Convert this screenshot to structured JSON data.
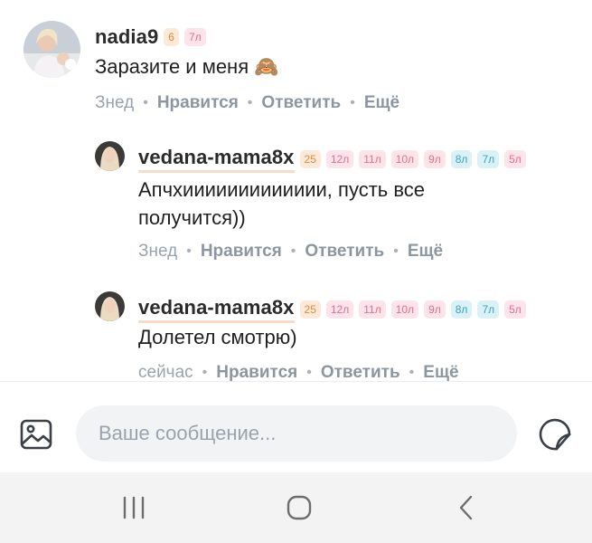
{
  "comments": [
    {
      "username": "nadia9",
      "badges": [
        {
          "text": "6",
          "kind": "level"
        },
        {
          "text": "7л",
          "kind": "pink"
        }
      ],
      "text": "Заразите и меня 🙈",
      "time": "Знед",
      "like": "Нравится",
      "reply": "Ответить",
      "more": "Ещё"
    },
    {
      "username": "vedana-mama8x",
      "badges": [
        {
          "text": "25",
          "kind": "level"
        },
        {
          "text": "12л",
          "kind": "pink"
        },
        {
          "text": "11л",
          "kind": "pink"
        },
        {
          "text": "10л",
          "kind": "pink"
        },
        {
          "text": "9л",
          "kind": "pink"
        },
        {
          "text": "8л",
          "kind": "blue"
        },
        {
          "text": "7л",
          "kind": "blue"
        },
        {
          "text": "5л",
          "kind": "pink"
        }
      ],
      "text_lines": [
        "Апчхиииииииииииии, пусть все",
        "получится))"
      ],
      "time": "Знед",
      "like": "Нравится",
      "reply": "Ответить",
      "more": "Ещё"
    },
    {
      "username": "vedana-mama8x",
      "badges": [
        {
          "text": "25",
          "kind": "level"
        },
        {
          "text": "12л",
          "kind": "pink"
        },
        {
          "text": "11л",
          "kind": "pink"
        },
        {
          "text": "10л",
          "kind": "pink"
        },
        {
          "text": "9л",
          "kind": "pink"
        },
        {
          "text": "8л",
          "kind": "blue"
        },
        {
          "text": "7л",
          "kind": "blue"
        },
        {
          "text": "5л",
          "kind": "pink"
        }
      ],
      "text": "Долетел смотрю)",
      "time": "сейчас",
      "like": "Нравится",
      "reply": "Ответить",
      "more": "Ещё"
    }
  ],
  "composer": {
    "placeholder": "Ваше сообщение...",
    "left_icon": "gallery-icon",
    "right_icon": "sticker-icon"
  },
  "navbar": {
    "icons": [
      "recent-apps-icon",
      "home-icon",
      "back-icon"
    ]
  },
  "colors": {
    "action_text": "#8d96a0",
    "input_bg": "#f1f3f5",
    "badge_level": "#fde9d8",
    "badge_pink": "#fde3ea",
    "badge_blue": "#daf1f6"
  }
}
